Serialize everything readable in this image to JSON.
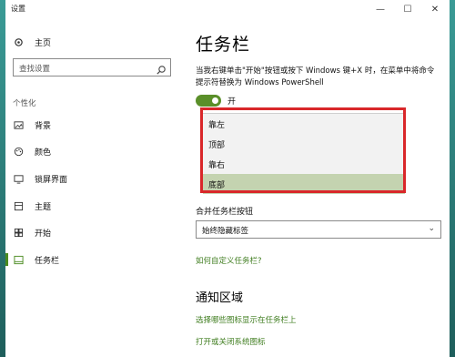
{
  "window": {
    "title": "设置"
  },
  "titlebar": {
    "minimize": "—",
    "maximize": "☐",
    "close": "✕"
  },
  "sidebar": {
    "home_label": "主页",
    "search_placeholder": "查找设置",
    "section_label": "个性化",
    "items": [
      {
        "label": "背景",
        "icon": "image-icon"
      },
      {
        "label": "颜色",
        "icon": "palette-icon"
      },
      {
        "label": "锁屏界面",
        "icon": "lockscreen-icon"
      },
      {
        "label": "主题",
        "icon": "theme-icon"
      },
      {
        "label": "开始",
        "icon": "start-icon"
      },
      {
        "label": "任务栏",
        "icon": "taskbar-icon",
        "active": true
      }
    ]
  },
  "main": {
    "title": "任务栏",
    "powershell_desc": "当我右键单击\"开始\"按钮或按下 Windows 键+X 时，在菜单中将命令提示符替换为 Windows PowerShell",
    "toggle_state": "开",
    "position_options": [
      "靠左",
      "顶部",
      "靠右",
      "底部"
    ],
    "selected_position": "底部",
    "combine_label": "合并任务栏按钮",
    "combine_value": "始终隐藏标签",
    "customize_link": "如何自定义任务栏?",
    "notification_title": "通知区域",
    "link_icons": "选择哪些图标显示在任务栏上",
    "link_system_icons": "打开或关闭系统图标"
  },
  "colors": {
    "accent": "#4a8a1f",
    "highlight_frame": "#d9272a",
    "selected_option": "#c4d3b0"
  }
}
